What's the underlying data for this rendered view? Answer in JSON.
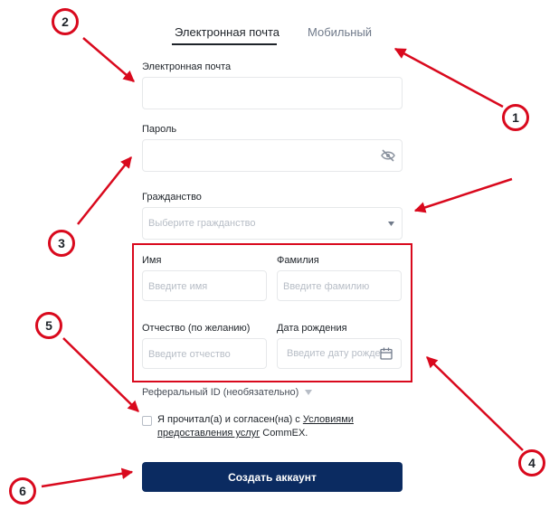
{
  "tabs": {
    "email": "Электронная почта",
    "mobile": "Мобильный"
  },
  "form": {
    "email_label": "Электронная почта",
    "password_label": "Пароль",
    "citizenship_label": "Гражданство",
    "citizenship_placeholder": "Выберите гражданство",
    "first_name_label": "Имя",
    "first_name_placeholder": "Введите имя",
    "last_name_label": "Фамилия",
    "last_name_placeholder": "Введите фамилию",
    "patronymic_label": "Отчество (по желанию)",
    "patronymic_placeholder": "Введите отчество",
    "birthdate_label": "Дата рождения",
    "birthdate_placeholder": "Введите дату рожде",
    "referral_label": "Реферальный ID (необязательно)",
    "agree_prefix": "Я прочитал(а) и согласен(на) с ",
    "agree_link_1": "Условиями",
    "agree_link_2": "предоставления услуг",
    "agree_suffix": " CommEX.",
    "submit_label": "Создать аккаунт"
  },
  "annotations": [
    "1",
    "2",
    "3",
    "4",
    "5",
    "6"
  ],
  "colors": {
    "annotation": "#d9091d",
    "submit_bg": "#0b2b61",
    "placeholder": "#b7bdc6"
  },
  "icons": {
    "password_toggle": "eye-slash-icon",
    "dropdown": "caret-down-icon",
    "calendar": "calendar-icon"
  }
}
